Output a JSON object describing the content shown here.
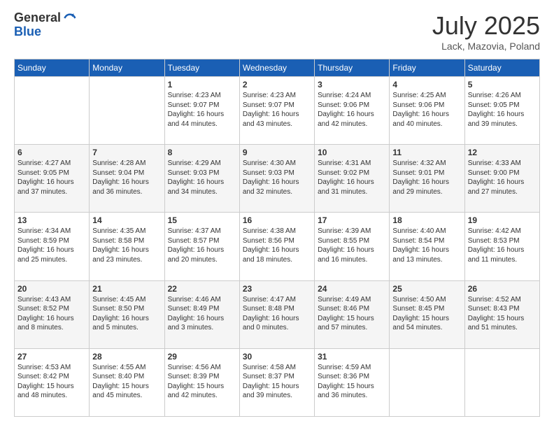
{
  "logo": {
    "general": "General",
    "blue": "Blue"
  },
  "header": {
    "month": "July 2025",
    "location": "Lack, Mazovia, Poland"
  },
  "days_of_week": [
    "Sunday",
    "Monday",
    "Tuesday",
    "Wednesday",
    "Thursday",
    "Friday",
    "Saturday"
  ],
  "weeks": [
    [
      {
        "day": "",
        "info": ""
      },
      {
        "day": "",
        "info": ""
      },
      {
        "day": "1",
        "info": "Sunrise: 4:23 AM\nSunset: 9:07 PM\nDaylight: 16 hours and 44 minutes."
      },
      {
        "day": "2",
        "info": "Sunrise: 4:23 AM\nSunset: 9:07 PM\nDaylight: 16 hours and 43 minutes."
      },
      {
        "day": "3",
        "info": "Sunrise: 4:24 AM\nSunset: 9:06 PM\nDaylight: 16 hours and 42 minutes."
      },
      {
        "day": "4",
        "info": "Sunrise: 4:25 AM\nSunset: 9:06 PM\nDaylight: 16 hours and 40 minutes."
      },
      {
        "day": "5",
        "info": "Sunrise: 4:26 AM\nSunset: 9:05 PM\nDaylight: 16 hours and 39 minutes."
      }
    ],
    [
      {
        "day": "6",
        "info": "Sunrise: 4:27 AM\nSunset: 9:05 PM\nDaylight: 16 hours and 37 minutes."
      },
      {
        "day": "7",
        "info": "Sunrise: 4:28 AM\nSunset: 9:04 PM\nDaylight: 16 hours and 36 minutes."
      },
      {
        "day": "8",
        "info": "Sunrise: 4:29 AM\nSunset: 9:03 PM\nDaylight: 16 hours and 34 minutes."
      },
      {
        "day": "9",
        "info": "Sunrise: 4:30 AM\nSunset: 9:03 PM\nDaylight: 16 hours and 32 minutes."
      },
      {
        "day": "10",
        "info": "Sunrise: 4:31 AM\nSunset: 9:02 PM\nDaylight: 16 hours and 31 minutes."
      },
      {
        "day": "11",
        "info": "Sunrise: 4:32 AM\nSunset: 9:01 PM\nDaylight: 16 hours and 29 minutes."
      },
      {
        "day": "12",
        "info": "Sunrise: 4:33 AM\nSunset: 9:00 PM\nDaylight: 16 hours and 27 minutes."
      }
    ],
    [
      {
        "day": "13",
        "info": "Sunrise: 4:34 AM\nSunset: 8:59 PM\nDaylight: 16 hours and 25 minutes."
      },
      {
        "day": "14",
        "info": "Sunrise: 4:35 AM\nSunset: 8:58 PM\nDaylight: 16 hours and 23 minutes."
      },
      {
        "day": "15",
        "info": "Sunrise: 4:37 AM\nSunset: 8:57 PM\nDaylight: 16 hours and 20 minutes."
      },
      {
        "day": "16",
        "info": "Sunrise: 4:38 AM\nSunset: 8:56 PM\nDaylight: 16 hours and 18 minutes."
      },
      {
        "day": "17",
        "info": "Sunrise: 4:39 AM\nSunset: 8:55 PM\nDaylight: 16 hours and 16 minutes."
      },
      {
        "day": "18",
        "info": "Sunrise: 4:40 AM\nSunset: 8:54 PM\nDaylight: 16 hours and 13 minutes."
      },
      {
        "day": "19",
        "info": "Sunrise: 4:42 AM\nSunset: 8:53 PM\nDaylight: 16 hours and 11 minutes."
      }
    ],
    [
      {
        "day": "20",
        "info": "Sunrise: 4:43 AM\nSunset: 8:52 PM\nDaylight: 16 hours and 8 minutes."
      },
      {
        "day": "21",
        "info": "Sunrise: 4:45 AM\nSunset: 8:50 PM\nDaylight: 16 hours and 5 minutes."
      },
      {
        "day": "22",
        "info": "Sunrise: 4:46 AM\nSunset: 8:49 PM\nDaylight: 16 hours and 3 minutes."
      },
      {
        "day": "23",
        "info": "Sunrise: 4:47 AM\nSunset: 8:48 PM\nDaylight: 16 hours and 0 minutes."
      },
      {
        "day": "24",
        "info": "Sunrise: 4:49 AM\nSunset: 8:46 PM\nDaylight: 15 hours and 57 minutes."
      },
      {
        "day": "25",
        "info": "Sunrise: 4:50 AM\nSunset: 8:45 PM\nDaylight: 15 hours and 54 minutes."
      },
      {
        "day": "26",
        "info": "Sunrise: 4:52 AM\nSunset: 8:43 PM\nDaylight: 15 hours and 51 minutes."
      }
    ],
    [
      {
        "day": "27",
        "info": "Sunrise: 4:53 AM\nSunset: 8:42 PM\nDaylight: 15 hours and 48 minutes."
      },
      {
        "day": "28",
        "info": "Sunrise: 4:55 AM\nSunset: 8:40 PM\nDaylight: 15 hours and 45 minutes."
      },
      {
        "day": "29",
        "info": "Sunrise: 4:56 AM\nSunset: 8:39 PM\nDaylight: 15 hours and 42 minutes."
      },
      {
        "day": "30",
        "info": "Sunrise: 4:58 AM\nSunset: 8:37 PM\nDaylight: 15 hours and 39 minutes."
      },
      {
        "day": "31",
        "info": "Sunrise: 4:59 AM\nSunset: 8:36 PM\nDaylight: 15 hours and 36 minutes."
      },
      {
        "day": "",
        "info": ""
      },
      {
        "day": "",
        "info": ""
      }
    ]
  ]
}
